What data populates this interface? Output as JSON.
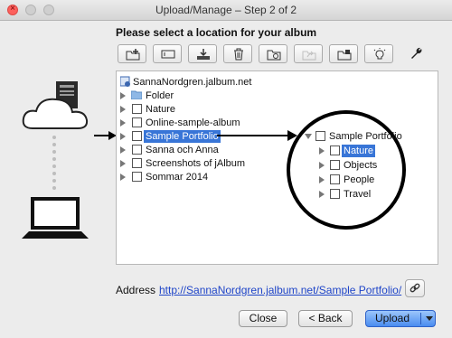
{
  "window": {
    "title": "Upload/Manage – Step 2 of 2"
  },
  "heading": "Please select a location for your album",
  "toolbar": {
    "buttons": [
      {
        "icon": "new-folder-icon",
        "enabled": true
      },
      {
        "icon": "rename-field-icon",
        "enabled": true
      },
      {
        "icon": "download-tray-icon",
        "enabled": true
      },
      {
        "icon": "trash-icon",
        "enabled": true
      },
      {
        "icon": "sync-folder-icon",
        "enabled": true
      },
      {
        "icon": "share-arrow-icon",
        "enabled": false
      },
      {
        "icon": "folder-properties-icon",
        "enabled": true
      },
      {
        "icon": "lightbulb-icon",
        "enabled": true
      }
    ],
    "settings_icon": "wrench-icon"
  },
  "tree": {
    "root": "SannaNordgren.jalbum.net",
    "items": [
      {
        "label": "Folder",
        "type": "folder"
      },
      {
        "label": "Nature",
        "type": "album"
      },
      {
        "label": "Online-sample-album",
        "type": "album"
      },
      {
        "label": "Sample Portfolio",
        "type": "album",
        "selected": true
      },
      {
        "label": "Sanna och Anna",
        "type": "album"
      },
      {
        "label": "Screenshots of jAlbum",
        "type": "album"
      },
      {
        "label": "Sommar 2014",
        "type": "album"
      }
    ]
  },
  "zoom": {
    "parent": "Sample Portfolio",
    "children": [
      {
        "label": "Nature",
        "selected": true
      },
      {
        "label": "Objects"
      },
      {
        "label": "People"
      },
      {
        "label": "Travel"
      }
    ]
  },
  "address": {
    "label": "Address",
    "url": "http://SannaNordgren.jalbum.net/Sample Portfolio/"
  },
  "buttons": {
    "close": "Close",
    "back": "< Back",
    "upload": "Upload"
  },
  "colors": {
    "selection": "#3875d7",
    "link": "#1f45c8",
    "primary": "#4a8cf0"
  }
}
